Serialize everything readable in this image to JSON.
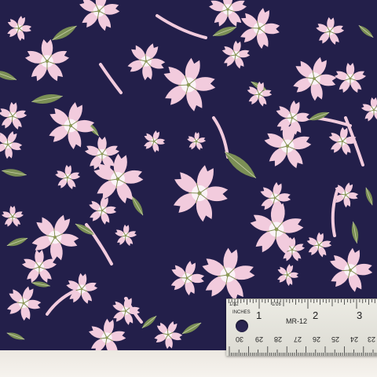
{
  "fabric": {
    "background_color": "#231f4a",
    "blossom_color": "#f2cbdd",
    "blossom_center_color": "#fbf3f7",
    "leaf_color": "#7b8f56",
    "branch_color": "#f2cbdd"
  },
  "ruler": {
    "unit_fraction": "1/32",
    "unit_label": "INCHES",
    "second_fraction": "1/16",
    "model": "MR-12",
    "inch_numbers": [
      "1",
      "2",
      "3"
    ],
    "cm_numbers": [
      "30",
      "29",
      "28",
      "27",
      "26",
      "25",
      "24",
      "23"
    ]
  },
  "paper": {
    "color": "#f3efe8"
  }
}
